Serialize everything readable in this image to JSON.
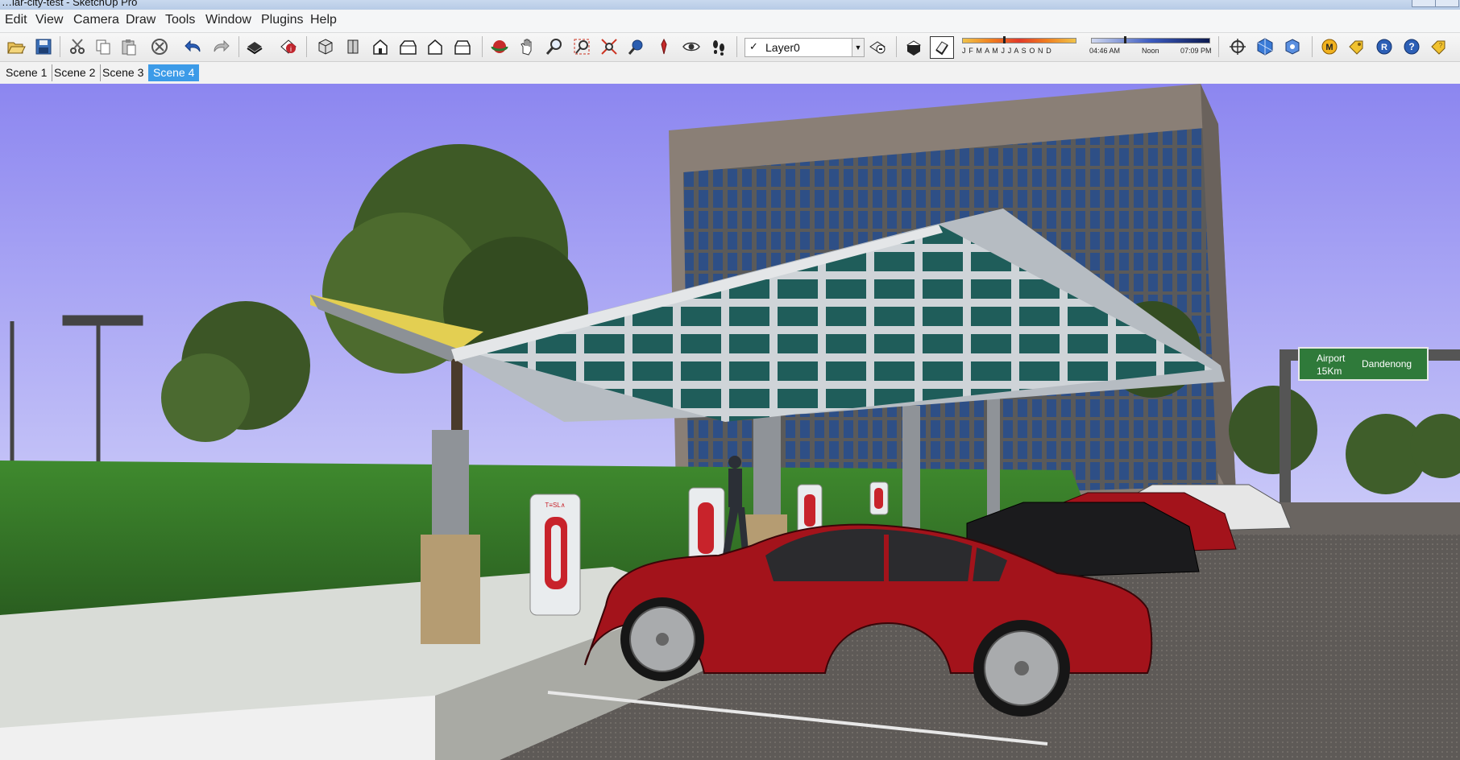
{
  "window": {
    "title": "…lar-city-test - SketchUp Pro"
  },
  "menu": [
    "Edit",
    "View",
    "Camera",
    "Draw",
    "Tools",
    "Window",
    "Plugins",
    "Help"
  ],
  "toolbar": {
    "layer": {
      "checked_glyph": "✓",
      "value": "Layer0"
    },
    "shadow_months": "J F M A M J J A S O N D",
    "time": {
      "start": "04:46 AM",
      "mid": "Noon",
      "end": "07:09 PM"
    }
  },
  "scenes": [
    {
      "label": "Scene 1",
      "active": false
    },
    {
      "label": "Scene 2",
      "active": false
    },
    {
      "label": "Scene 3",
      "active": false
    },
    {
      "label": "Scene 4",
      "active": true
    }
  ],
  "viewport": {
    "road_sign": {
      "line1": "Airport",
      "line2": "15Km",
      "right": "Dandenong"
    },
    "charger_label": "T≡SL∧",
    "colors": {
      "sky": "#8c86f0",
      "car_red": "#a3131b",
      "grass": "#3f8a2e",
      "glass": "#2e4f86",
      "accent_tab": "#3c9be8"
    }
  }
}
